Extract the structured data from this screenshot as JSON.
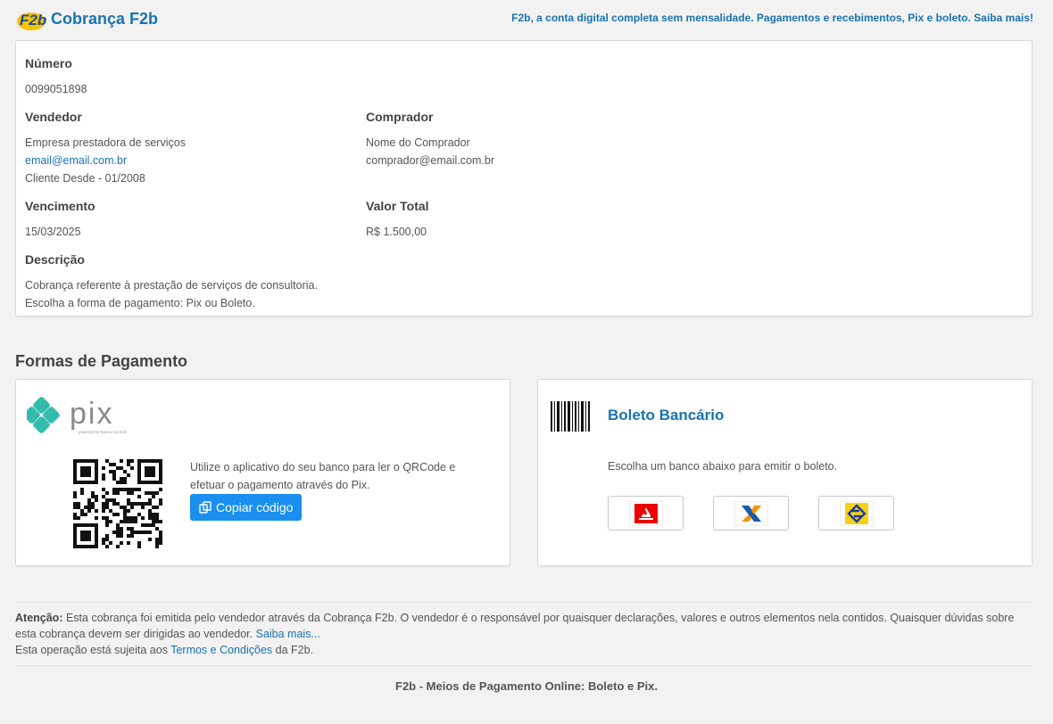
{
  "header": {
    "logo_text": "F2b",
    "brand": "Cobrança F2b",
    "promo": "F2b, a conta digital completa sem mensalidade. Pagamentos e recebimentos, Pix e boleto. Saiba mais!"
  },
  "invoice": {
    "numero_label": "Número",
    "numero": "0099051898",
    "vendedor_label": "Vendedor",
    "vendedor_nome": "Empresa prestadora de serviços",
    "vendedor_email": "email@email.com.br",
    "vendedor_desde": "Cliente Desde - 01/2008",
    "comprador_label": "Comprador",
    "comprador_nome": "Nome do Comprador",
    "comprador_email": "comprador@email.com.br",
    "vencimento_label": "Vencimento",
    "vencimento": "15/03/2025",
    "valor_label": "Valor Total",
    "valor": "R$ 1.500,00",
    "descricao_label": "Descrição",
    "descricao_1": "Cobrança referente à prestação de serviços de consultoria.",
    "descricao_2": "Escolha a forma de pagamento: Pix ou Boleto."
  },
  "payments": {
    "title": "Formas de Pagamento",
    "pix": {
      "logo_text": "pix",
      "logo_sub": "powered by Banco Central",
      "instructions": "Utilize o aplicativo do seu banco para ler o QRCode e efetuar o pagamento através do Pix.",
      "copy_label": "Copiar código"
    },
    "boleto": {
      "title": "Boleto Bancário",
      "instructions": "Escolha um banco abaixo para emitir o boleto.",
      "banks": [
        {
          "icon": "santander-icon",
          "color": "#ec0000"
        },
        {
          "icon": "caixa-icon",
          "color": "#1c5aa6"
        },
        {
          "icon": "banco-do-brasil-icon",
          "color": "#f8d117"
        }
      ]
    }
  },
  "footer": {
    "attention_label": "Atenção:",
    "attention_text": " Esta cobrança foi emitida pelo vendedor através da Cobrança F2b. O vendedor é o responsável por quaisquer declarações, valores e outros elementos nela contidos. Quaisquer dúvidas sobre esta cobrança devem ser dirigidas ao vendedor. ",
    "saiba_mais": "Saiba mais...",
    "terms_prefix": "Esta operação está sujeita aos ",
    "terms_link": "Termos e Condições",
    "terms_suffix": " da F2b.",
    "tagline": "F2b - Meios de Pagamento Online: Boleto e Pix."
  }
}
